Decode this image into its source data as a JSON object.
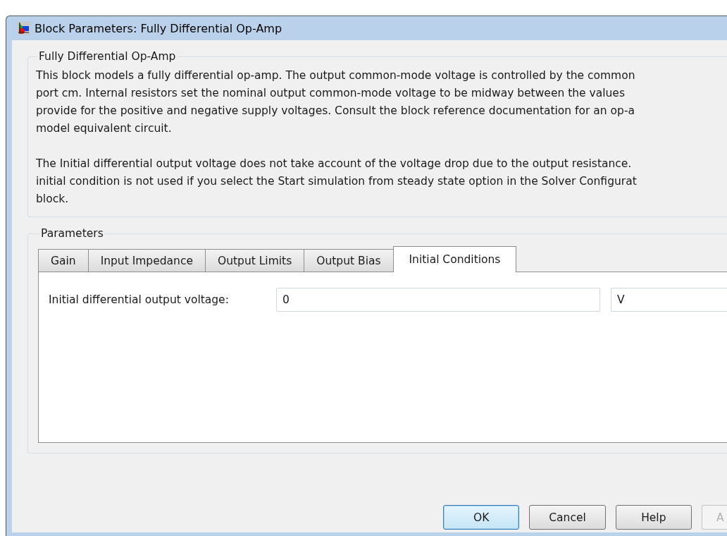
{
  "window": {
    "title": "Block Parameters: Fully Differential Op-Amp"
  },
  "description": {
    "title": "Fully Differential Op-Amp",
    "paragraphs": [
      [
        "This block models a fully differential op-amp. The output common-mode voltage is controlled by the common",
        "port cm. Internal resistors set the nominal output common-mode voltage to be midway between the values",
        "provide for the positive and negative supply voltages. Consult the block reference documentation for an op-a",
        "model equivalent circuit."
      ],
      [
        "The Initial differential output voltage does not take account of the voltage drop due to the output resistance.",
        "initial condition is not used if you select the Start simulation from steady state option in the Solver Configurat",
        "block."
      ]
    ]
  },
  "parameters": {
    "title": "Parameters",
    "tabs": [
      {
        "label": "Gain",
        "selected": false
      },
      {
        "label": "Input Impedance",
        "selected": false
      },
      {
        "label": "Output Limits",
        "selected": false
      },
      {
        "label": "Output Bias",
        "selected": false
      },
      {
        "label": "Initial Conditions",
        "selected": true
      }
    ],
    "fields": [
      {
        "label": "Initial differential output voltage:",
        "value": "0",
        "unit": "V"
      }
    ]
  },
  "buttons": [
    {
      "label": "OK",
      "focused": true,
      "disabled": false
    },
    {
      "label": "Cancel",
      "focused": false,
      "disabled": false
    },
    {
      "label": "Help",
      "focused": false,
      "disabled": false
    },
    {
      "label": "A",
      "focused": false,
      "disabled": true
    }
  ]
}
